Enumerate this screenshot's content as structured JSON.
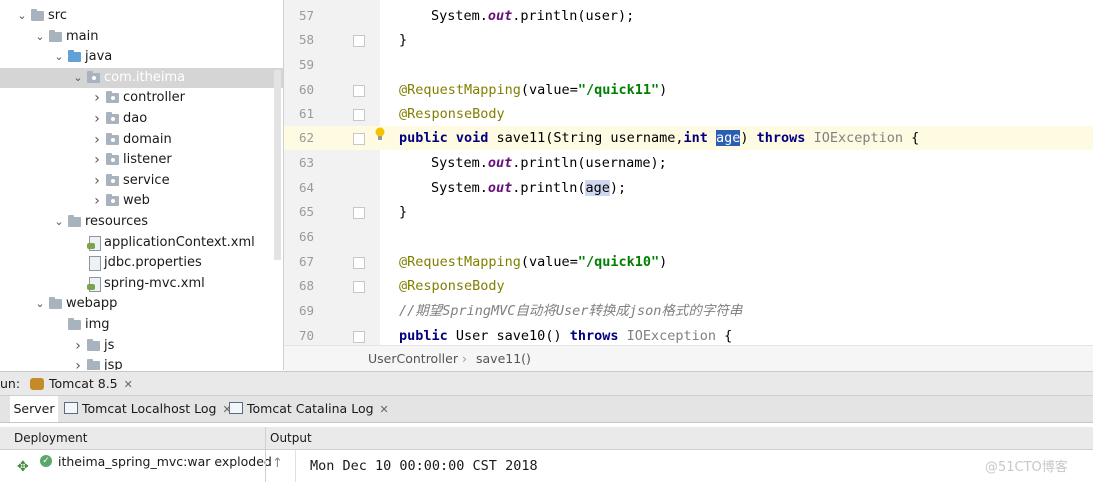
{
  "project_tree": [
    {
      "label": "src",
      "kind": "folder",
      "expanded": true
    },
    {
      "label": "main",
      "kind": "folder",
      "expanded": true
    },
    {
      "label": "java",
      "kind": "source-folder",
      "expanded": true
    },
    {
      "label": "com.itheima",
      "kind": "package",
      "expanded": true,
      "selected": true
    },
    {
      "label": "controller",
      "kind": "package",
      "expanded": false
    },
    {
      "label": "dao",
      "kind": "package",
      "expanded": false
    },
    {
      "label": "domain",
      "kind": "package",
      "expanded": false
    },
    {
      "label": "listener",
      "kind": "package",
      "expanded": false
    },
    {
      "label": "service",
      "kind": "package",
      "expanded": false
    },
    {
      "label": "web",
      "kind": "package",
      "expanded": false
    },
    {
      "label": "resources",
      "kind": "folder",
      "expanded": true
    },
    {
      "label": "applicationContext.xml",
      "kind": "xml-file"
    },
    {
      "label": "jdbc.properties",
      "kind": "file"
    },
    {
      "label": "spring-mvc.xml",
      "kind": "xml-file"
    },
    {
      "label": "webapp",
      "kind": "folder",
      "expanded": true
    },
    {
      "label": "img",
      "kind": "folder"
    },
    {
      "label": "js",
      "kind": "folder",
      "expanded": false
    },
    {
      "label": "jsp",
      "kind": "folder",
      "expanded": false
    }
  ],
  "editor": {
    "line_numbers": [
      "57",
      "58",
      "59",
      "60",
      "61",
      "62",
      "63",
      "64",
      "65",
      "66",
      "67",
      "68",
      "69",
      "70"
    ],
    "lines": {
      "l57": "System.",
      "l57_out": "out",
      "l57_rest": ".println(user);",
      "l58": "}",
      "l60_ann": "@RequestMapping",
      "l60_mid": "(value=",
      "l60_str": "\"/quick11\"",
      "l60_end": ")",
      "l61": "@ResponseBody",
      "l62_kw1": "public void",
      "l62_a": " save11(String username,",
      "l62_kw2": "int",
      "l62_sel": "age",
      "l62_b": ") ",
      "l62_kw3": "throws",
      "l62_ex": " IOException",
      "l62_end": " {",
      "l63": "System.",
      "l63_out": "out",
      "l63_rest": ".println(username);",
      "l64": "System.",
      "l64_out": "out",
      "l64_a": ".println(",
      "l64_age": "age",
      "l64_end": ");",
      "l65": "}",
      "l67_ann": "@RequestMapping",
      "l67_mid": "(value=",
      "l67_str": "\"/quick10\"",
      "l67_end": ")",
      "l68": "@ResponseBody",
      "l69": "//期望SpringMVC自动将User转换成json格式的字符串",
      "l70_kw": "public",
      "l70_a": " User save10() ",
      "l70_kw2": "throws",
      "l70_ex": " IOException",
      "l70_end": " {"
    },
    "breadcrumb": [
      "UserController",
      "save11()"
    ]
  },
  "run": {
    "prefix": "un:",
    "config": "Tomcat 8.5",
    "tabs": [
      "Server",
      "Tomcat Localhost Log",
      "Tomcat Catalina Log"
    ],
    "deployment_header": "Deployment",
    "output_header": "Output",
    "deployment_item": "itheima_spring_mvc:war exploded",
    "output_line": "Mon Dec 10 00:00:00 CST 2018"
  },
  "watermark": "@51CTO博客"
}
